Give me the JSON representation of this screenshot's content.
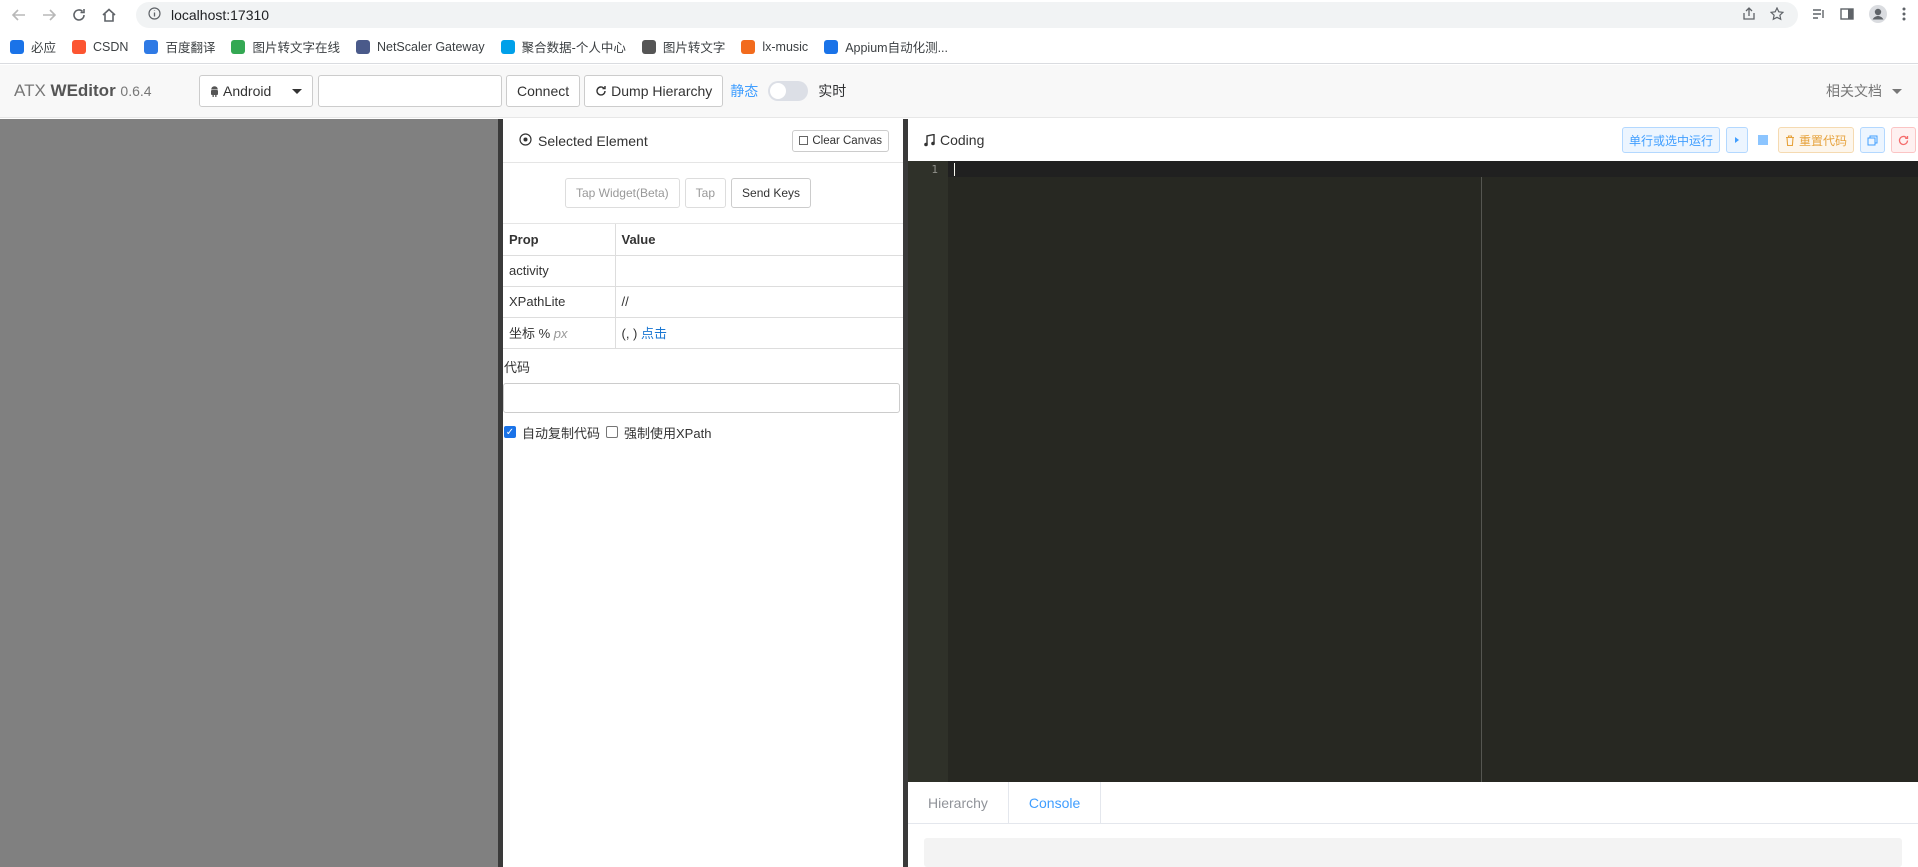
{
  "browser": {
    "url": "localhost:17310",
    "bookmarks": [
      {
        "label": "必应",
        "icon": "search-icon",
        "color": "#1a73e8"
      },
      {
        "label": "CSDN",
        "icon": "csdn-icon",
        "color": "#fc5531"
      },
      {
        "label": "百度翻译",
        "icon": "translate-icon",
        "color": "#2f7ae5"
      },
      {
        "label": "图片转文字在线",
        "icon": "image-text-icon",
        "color": "#34a853"
      },
      {
        "label": "NetScaler Gateway",
        "icon": "gateway-icon",
        "color": "#4a5a8a"
      },
      {
        "label": "聚合数据-个人中心",
        "icon": "juhe-icon",
        "color": "#00a0e9"
      },
      {
        "label": "图片转文字",
        "icon": "doc-icon",
        "color": "#555555"
      },
      {
        "label": "lx-music",
        "icon": "music-flag-icon",
        "color": "#f26b1d"
      },
      {
        "label": "Appium自动化测...",
        "icon": "bilibili-icon",
        "color": "#1a73e8"
      }
    ]
  },
  "app": {
    "brand_prefix": "ATX ",
    "brand_name": "WEditor",
    "version": "0.6.4",
    "platform": "Android",
    "serial_value": "",
    "connect_label": "Connect",
    "dump_label": "Dump Hierarchy",
    "mode_static": "静态",
    "mode_live": "实时",
    "docs_label": "相关文档"
  },
  "selected": {
    "title": "Selected Element",
    "clear_label": "Clear Canvas",
    "tap_widget_label": "Tap Widget(Beta)",
    "tap_label": "Tap",
    "send_keys_label": "Send Keys",
    "prop_header": "Prop",
    "value_header": "Value",
    "rows": {
      "activity_label": "activity",
      "activity_value": "",
      "xpath_label": "XPathLite",
      "xpath_value": "//",
      "coord_label": "坐标 %",
      "coord_unit": "px",
      "coord_value": "(, )",
      "coord_link": "点击"
    },
    "code_label": "代码",
    "code_value": "",
    "auto_copy_label": "自动复制代码",
    "auto_copy_checked": true,
    "force_xpath_label": "强制使用XPath",
    "force_xpath_checked": false
  },
  "coding": {
    "title": "Coding",
    "run_label": "单行或选中运行",
    "reset_label": "重置代码",
    "line_number": "1",
    "tabs": [
      "Hierarchy",
      "Console"
    ],
    "active_tab": "Console"
  }
}
